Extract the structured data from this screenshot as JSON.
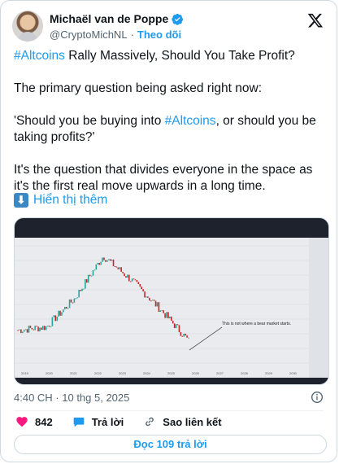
{
  "author": {
    "name": "Michaël van de Poppe",
    "handle": "@CryptoMichNL",
    "separator": "·",
    "follow_label": "Theo dõi"
  },
  "tweet": {
    "line1_hashtag": "#Altcoins",
    "line1_rest": " Rally Massively, Should You Take Profit?",
    "para2": "The primary question being asked right now:",
    "para3_start": "'Should you be buying into ",
    "para3_hashtag": "#Altcoins",
    "para3_end": ", or should you be taking profits?'",
    "para4": "It's the question that divides everyone in the space as it's the first real move upwards in a long time.",
    "show_more": "Hiển thị thêm"
  },
  "chart_image": {
    "annotation": "This is not where a bear market starts.",
    "x_labels": [
      "2019",
      "2020",
      "2021",
      "2022",
      "2023",
      "2024",
      "2025",
      "2026",
      "2027",
      "2028",
      "2029",
      "2030"
    ]
  },
  "chart_data": {
    "type": "line",
    "title": "",
    "xlabel": "",
    "ylabel": "",
    "x": [
      "2019",
      "2020",
      "2021",
      "2022",
      "2023",
      "2024",
      "2025"
    ],
    "series": [
      {
        "values": [
          0.25,
          0.28,
          0.55,
          0.95,
          0.72,
          0.45,
          0.15
        ]
      }
    ]
  },
  "meta": {
    "timestamp": "4:40 CH · 10 thg 5, 2025"
  },
  "actions": {
    "likes": "842",
    "reply_label": "Trả lời",
    "copy_link_label": "Sao liên kết",
    "read_replies": "Đọc 109 trả lời"
  },
  "colors": {
    "accent": "#1d9bf0",
    "like": "#f91880"
  }
}
